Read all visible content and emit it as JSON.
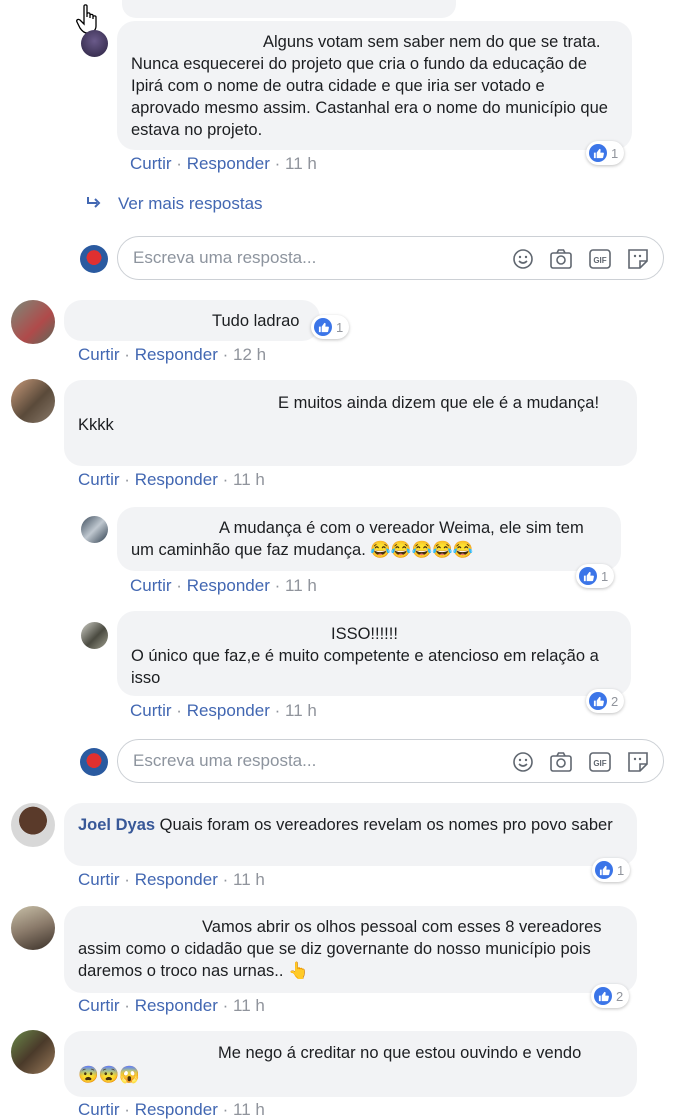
{
  "labels": {
    "like": "Curtir",
    "reply": "Responder",
    "dot": "·"
  },
  "comments": [
    {
      "text": "Alguns votam sem saber nem do que se trata. Nunca esquecerei do projeto que cria o fundo da educação de Ipirá com o nome de outra cidade e que iria ser votado e aprovado mesmo assim. Castanhal era o nome do município que estava no projeto.",
      "time": "11 h",
      "likes": "1"
    },
    {
      "text": "Tudo ladrao",
      "time": "12 h",
      "likes": "1"
    },
    {
      "text": "E muitos ainda dizem que ele é a mudança!",
      "text2": "Kkkk",
      "time": "11 h"
    },
    {
      "text": "A mudança é com o vereador Weima, ele sim tem um caminhão que faz mudança. 😂😂😂😂😂",
      "time": "11 h",
      "likes": "1"
    },
    {
      "text": "ISSO!!!!!!",
      "text2": "O único que faz,e é muito competente e atencioso em relação a isso",
      "time": "11 h",
      "likes": "2"
    },
    {
      "author": "Joel Dyas",
      "text": "Quais foram os vereadores revelam os nomes pro povo saber",
      "time": "11 h",
      "likes": "1"
    },
    {
      "text": "Vamos abrir os olhos pessoal com esses 8 vereadores assim como o cidadão que se diz governante do nosso município pois daremos o troco nas urnas.. 👆",
      "time": "11 h",
      "likes": "2"
    },
    {
      "text": "Me nego á creditar no que estou ouvindo e vendo",
      "text2": "😨😨😱",
      "time": "11 h"
    }
  ],
  "more_replies": "Ver mais respostas",
  "reply_placeholder": "Escreva uma resposta...",
  "colors": {
    "link": "#4267b2",
    "bubble": "#f2f3f5",
    "like": "#3b75e8",
    "muted": "#90949c"
  }
}
